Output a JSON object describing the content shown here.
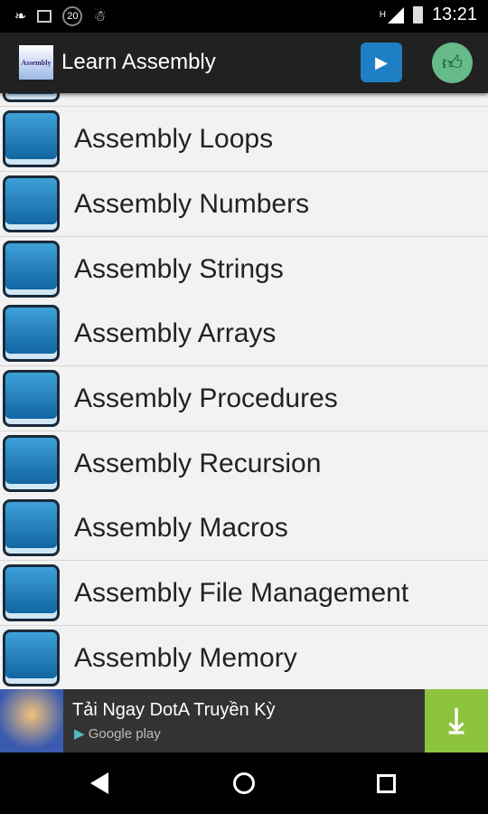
{
  "status_bar": {
    "time": "13:21",
    "notification_count": "20",
    "network": "H",
    "icons": [
      "bird-icon",
      "image-icon",
      "badge-icon",
      "android-icon",
      "signal-icon",
      "battery-icon"
    ]
  },
  "app_bar": {
    "logo_text": "Assembly",
    "title": "Learn Assembly",
    "actions": [
      "play-store-icon",
      "thumbs-up-icon"
    ]
  },
  "list": {
    "items": [
      {
        "label": "Assembly Loops"
      },
      {
        "label": "Assembly Numbers"
      },
      {
        "label": "Assembly Strings"
      },
      {
        "label": "Assembly Arrays"
      },
      {
        "label": "Assembly Procedures"
      },
      {
        "label": "Assembly Recursion"
      },
      {
        "label": "Assembly Macros"
      },
      {
        "label": "Assembly File Management"
      },
      {
        "label": "Assembly Memory"
      }
    ]
  },
  "ad": {
    "title": "Tải Ngay DotA Truyền Kỳ",
    "store": "Google play",
    "accent": "#8dc43f"
  },
  "nav": [
    "back-icon",
    "home-icon",
    "recents-icon"
  ]
}
